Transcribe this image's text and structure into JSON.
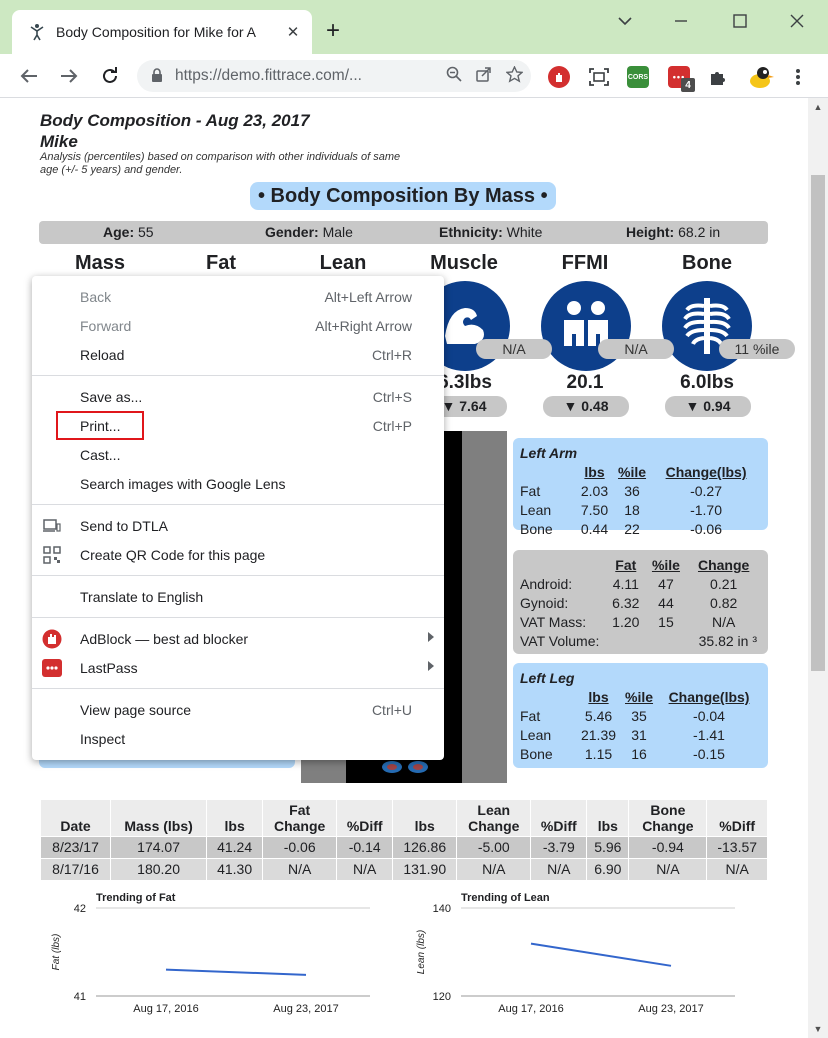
{
  "browser": {
    "tab_title": "Body Composition for Mike for A",
    "new_tab": "+",
    "url": "https://demo.fittrace.com/...",
    "ext_badge": "4",
    "ext_cors": "CORS"
  },
  "report": {
    "title": "Body Composition - Aug 23, 2017",
    "name": "Mike",
    "note": "Analysis (percentiles) based on comparison with other individuals of same age (+/- 5 years) and gender.",
    "section": "• Body Composition By Mass •",
    "info": {
      "age_label": "Age:",
      "age": "55",
      "gender_label": "Gender:",
      "gender": "Male",
      "ethnicity_label": "Ethnicity:",
      "ethnicity": "White",
      "height_label": "Height:",
      "height": "68.2 in"
    },
    "metrics": [
      {
        "name": "Mass"
      },
      {
        "name": "Fat"
      },
      {
        "name": "Lean"
      },
      {
        "name": "Muscle",
        "pct": "N/A",
        "value": "6.3lbs",
        "delta": "▼ 7.64"
      },
      {
        "name": "FFMI",
        "pct": "N/A",
        "value": "20.1",
        "delta": "▼ 0.48"
      },
      {
        "name": "Bone",
        "pct": "11 %ile",
        "value": "6.0lbs",
        "delta": "▼ 0.94"
      }
    ],
    "left_arm": {
      "title": "Left Arm",
      "headers": [
        "",
        "lbs",
        "%ile",
        "Change(lbs)"
      ],
      "rows": [
        [
          "Fat",
          "2.03",
          "36",
          "-0.27"
        ],
        [
          "Lean",
          "7.50",
          "18",
          "-1.70"
        ],
        [
          "Bone",
          "0.44",
          "22",
          "-0.06"
        ]
      ]
    },
    "trunk": {
      "headers": [
        "",
        "Fat",
        "%ile",
        "Change"
      ],
      "rows": [
        [
          "Android:",
          "4.11",
          "47",
          "0.21"
        ],
        [
          "Gynoid:",
          "6.32",
          "44",
          "0.82"
        ],
        [
          "VAT Mass:",
          "1.20",
          "15",
          "N/A"
        ]
      ],
      "vat_volume_label": "VAT Volume:",
      "vat_volume": "35.82 in ³"
    },
    "left_leg": {
      "title": "Left Leg",
      "headers": [
        "",
        "lbs",
        "%ile",
        "Change(lbs)"
      ],
      "rows": [
        [
          "Fat",
          "5.46",
          "35",
          "-0.04"
        ],
        [
          "Lean",
          "21.39",
          "31",
          "-1.41"
        ],
        [
          "Bone",
          "1.15",
          "16",
          "-0.15"
        ]
      ]
    },
    "history": {
      "headers": [
        "Date",
        "Mass (lbs)",
        "lbs",
        "Fat Change",
        "%Diff",
        "lbs",
        "Lean Change",
        "%Diff",
        "lbs",
        "Bone Change",
        "%Diff"
      ],
      "rows": [
        [
          "8/23/17",
          "174.07",
          "41.24",
          "-0.06",
          "-0.14",
          "126.86",
          "-5.00",
          "-3.79",
          "5.96",
          "-0.94",
          "-13.57"
        ],
        [
          "8/17/16",
          "180.20",
          "41.30",
          "N/A",
          "N/A",
          "131.90",
          "N/A",
          "N/A",
          "6.90",
          "N/A",
          "N/A"
        ]
      ]
    }
  },
  "chart_data": [
    {
      "type": "line",
      "title": "Trending of Fat",
      "ylabel": "Fat (lbs)",
      "xlabel": "",
      "categories": [
        "Aug 17, 2016",
        "Aug 23, 2017"
      ],
      "ylim": [
        41,
        42
      ],
      "yticks": [
        "42",
        "41"
      ],
      "series": [
        {
          "values": [
            41.3,
            41.24
          ]
        }
      ],
      "color": "#3366cc",
      "grid": true
    },
    {
      "type": "line",
      "title": "Trending of Lean",
      "ylabel": "Lean (lbs)",
      "xlabel": "",
      "categories": [
        "Aug 17, 2016",
        "Aug 23, 2017"
      ],
      "ylim": [
        120,
        140
      ],
      "yticks": [
        "140",
        "120"
      ],
      "series": [
        {
          "values": [
            131.9,
            126.86
          ]
        }
      ],
      "color": "#3366cc",
      "grid": true
    }
  ],
  "context_menu": {
    "items": [
      {
        "label": "Back",
        "key": "Alt+Left Arrow",
        "disabled": true
      },
      {
        "label": "Forward",
        "key": "Alt+Right Arrow",
        "disabled": true
      },
      {
        "label": "Reload",
        "key": "Ctrl+R"
      },
      {
        "sep": true
      },
      {
        "label": "Save as...",
        "key": "Ctrl+S"
      },
      {
        "label": "Print...",
        "key": "Ctrl+P"
      },
      {
        "label": "Cast...",
        "key": ""
      },
      {
        "label": "Search images with Google Lens",
        "key": ""
      },
      {
        "sep": true
      },
      {
        "label": "Send to DTLA",
        "key": "",
        "icon": "devices-icon"
      },
      {
        "label": "Create QR Code for this page",
        "key": "",
        "icon": "qr-code-icon"
      },
      {
        "sep": true
      },
      {
        "label": "Translate to English",
        "key": ""
      },
      {
        "sep": true
      },
      {
        "label": "AdBlock — best ad blocker",
        "key": "",
        "icon": "adblock-icon",
        "submenu": true
      },
      {
        "label": "LastPass",
        "key": "",
        "icon": "lastpass-icon",
        "submenu": true
      },
      {
        "sep": true
      },
      {
        "label": "View page source",
        "key": "Ctrl+U"
      },
      {
        "label": "Inspect",
        "key": ""
      }
    ],
    "highlight_color": "#e0161b"
  }
}
